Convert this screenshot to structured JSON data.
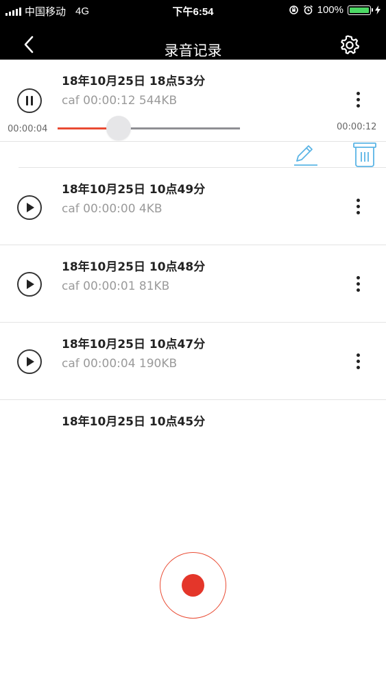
{
  "status_bar": {
    "carrier": "中国移动",
    "network": "4G",
    "time": "下午6:54",
    "battery": "100%"
  },
  "nav": {
    "title": "录音记录",
    "back_icon": "chevron-left-icon",
    "settings_icon": "gear-icon"
  },
  "player": {
    "elapsed": "00:00:04",
    "duration": "00:00:12",
    "progress_fraction": 0.333
  },
  "recordings": [
    {
      "title": "18年10月25日 18点53分",
      "meta": "caf 00:00:12 544KB",
      "state": "playing"
    },
    {
      "title": "18年10月25日 10点49分",
      "meta": "caf 00:00:00 4KB",
      "state": "stopped"
    },
    {
      "title": "18年10月25日 10点48分",
      "meta": "caf 00:00:01 81KB",
      "state": "stopped"
    },
    {
      "title": "18年10月25日 10点47分",
      "meta": "caf 00:00:04 190KB",
      "state": "stopped"
    },
    {
      "title": "18年10月25日 10点45分",
      "meta": "",
      "state": "stopped"
    }
  ],
  "colors": {
    "accent": "#e94a32",
    "record": "#e4362a",
    "action_blue": "#5ab4e5",
    "battery_green": "#4cd964",
    "header": "#000000"
  }
}
